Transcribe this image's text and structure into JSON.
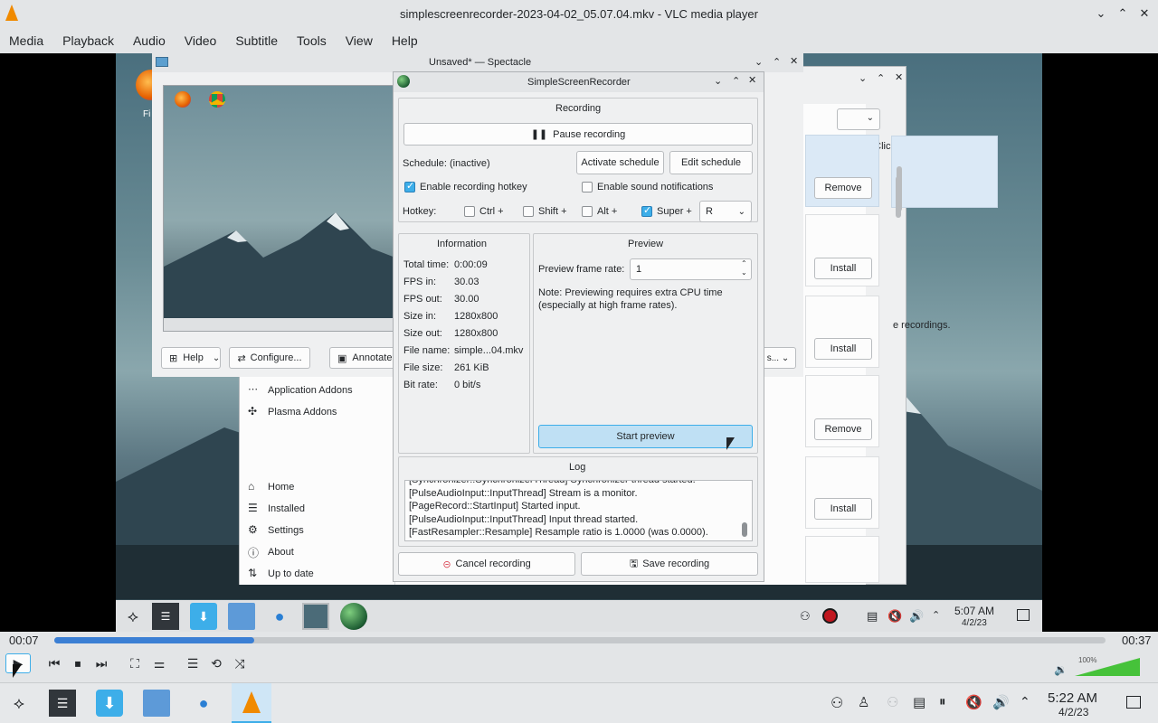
{
  "window": {
    "title": "simplescreenrecorder-2023-04-02_05.07.04.mkv - VLC media player"
  },
  "menu": [
    "Media",
    "Playback",
    "Audio",
    "Video",
    "Subtitle",
    "Tools",
    "View",
    "Help"
  ],
  "spectacle": {
    "title": "Unsaved* — Spectacle",
    "help": "Help",
    "configure": "Configure...",
    "annotate": "Annotate",
    "desktop_icons": [
      "Firefox",
      "Google Chrome"
    ]
  },
  "discover": {
    "addons": [
      "Application Addons",
      "Plasma Addons"
    ],
    "nav": [
      "Home",
      "Installed",
      "Settings",
      "About",
      "Up to date"
    ],
    "snippets": {
      "click": "n Click",
      "recordings": "e recordings."
    },
    "buttons": [
      "Remove",
      "Install",
      "Install",
      "Remove",
      "Install"
    ],
    "desk_label": "Fi"
  },
  "ssr": {
    "title": "SimpleScreenRecorder",
    "recording_header": "Recording",
    "pause": "Pause recording",
    "schedule": "Schedule: (inactive)",
    "activate_schedule": "Activate schedule",
    "edit_schedule": "Edit schedule",
    "enable_hotkey": "Enable recording hotkey",
    "enable_sound": "Enable sound notifications",
    "hotkey_label": "Hotkey:",
    "ctrl": "Ctrl +",
    "shift": "Shift +",
    "alt": "Alt +",
    "super": "Super +",
    "key": "R",
    "info_header": "Information",
    "info": [
      {
        "k": "Total time:",
        "v": "0:00:09"
      },
      {
        "k": "FPS in:",
        "v": "30.03"
      },
      {
        "k": "FPS out:",
        "v": "30.00"
      },
      {
        "k": "Size in:",
        "v": "1280x800"
      },
      {
        "k": "Size out:",
        "v": "1280x800"
      },
      {
        "k": "File name:",
        "v": "simple...04.mkv"
      },
      {
        "k": "File size:",
        "v": "261 KiB"
      },
      {
        "k": "Bit rate:",
        "v": "0 bit/s"
      }
    ],
    "preview_header": "Preview",
    "preview_rate_label": "Preview frame rate:",
    "preview_rate": "1",
    "preview_note": "Note: Previewing requires extra CPU time (especially at high frame rates).",
    "start_preview": "Start preview",
    "log_header": "Log",
    "log": [
      "[Synchronizer::SynchronizerThread] Synchronizer thread started.",
      "[PulseAudioInput::InputThread] Stream is a monitor.",
      "[PageRecord::StartInput] Started input.",
      "[PulseAudioInput::InputThread] Input thread started.",
      "[FastResampler::Resample] Resample ratio is 1.0000 (was 0.0000)."
    ],
    "cancel": "Cancel recording",
    "save": "Save recording"
  },
  "inner_tray": {
    "time": "5:07 AM",
    "date": "4/2/23"
  },
  "player": {
    "elapsed": "00:07",
    "total": "00:37",
    "progress": 0.19,
    "volume": "100%",
    "volume_level": 1.0
  },
  "tray": {
    "time": "5:22 AM",
    "date": "4/2/23"
  },
  "colors": {
    "accent": "#3daee9",
    "progress": "#3b7fd4",
    "volume": "#46c23a"
  }
}
